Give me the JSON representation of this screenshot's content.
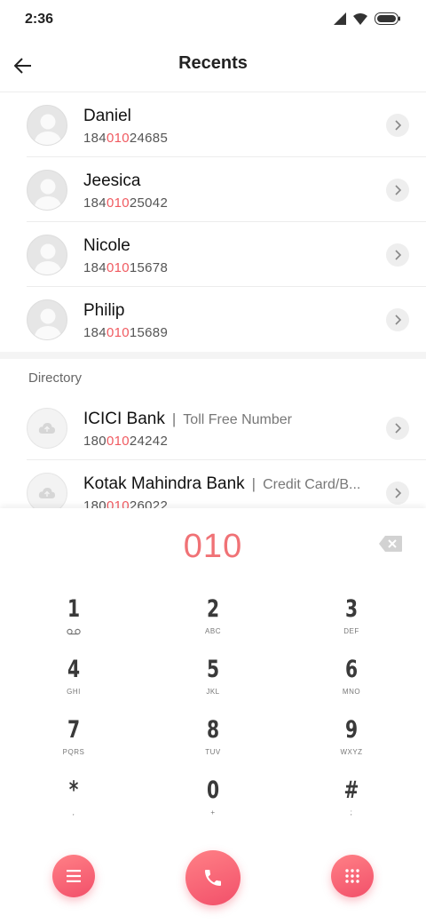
{
  "status_bar": {
    "time": "2:36"
  },
  "header": {
    "title": "Recents"
  },
  "recents": [
    {
      "name": "Daniel",
      "number_prefix": "184",
      "number_match": "010",
      "number_suffix": "24685"
    },
    {
      "name": "Jeesica",
      "number_prefix": "184",
      "number_match": "010",
      "number_suffix": "25042"
    },
    {
      "name": "Nicole",
      "number_prefix": "184",
      "number_match": "010",
      "number_suffix": "15678"
    },
    {
      "name": "Philip",
      "number_prefix": "184",
      "number_match": "010",
      "number_suffix": "15689"
    }
  ],
  "directory": {
    "label": "Directory",
    "items": [
      {
        "name": "ICICI Bank",
        "separator": "|",
        "subtitle": "Toll Free Number",
        "number_prefix": "180",
        "number_match": "010",
        "number_suffix": "24242"
      },
      {
        "name": "Kotak Mahindra Bank",
        "separator": "|",
        "subtitle": "Credit Card/B...",
        "number_prefix": "180",
        "number_match": "010",
        "number_suffix": "26022"
      }
    ]
  },
  "dialer": {
    "input": "010",
    "keys": [
      {
        "digit": "1",
        "letters": ""
      },
      {
        "digit": "2",
        "letters": "ABC"
      },
      {
        "digit": "3",
        "letters": "DEF"
      },
      {
        "digit": "4",
        "letters": "GHI"
      },
      {
        "digit": "5",
        "letters": "JKL"
      },
      {
        "digit": "6",
        "letters": "MNO"
      },
      {
        "digit": "7",
        "letters": "PQRS"
      },
      {
        "digit": "8",
        "letters": "TUV"
      },
      {
        "digit": "9",
        "letters": "WXYZ"
      },
      {
        "digit": "*",
        "letters": ","
      },
      {
        "digit": "0",
        "letters": "+"
      },
      {
        "digit": "#",
        "letters": ";"
      }
    ]
  },
  "icons": {
    "back": "arrow-left-icon",
    "chevron": "chevron-right-icon",
    "avatar": "person-icon",
    "cloud": "cloud-icon",
    "backspace": "backspace-icon",
    "voicemail": "voicemail-icon",
    "menu": "menu-icon",
    "call": "phone-icon",
    "keypad": "dialpad-icon"
  },
  "colors": {
    "accent": "#f05a60",
    "highlight": "#f07276"
  }
}
